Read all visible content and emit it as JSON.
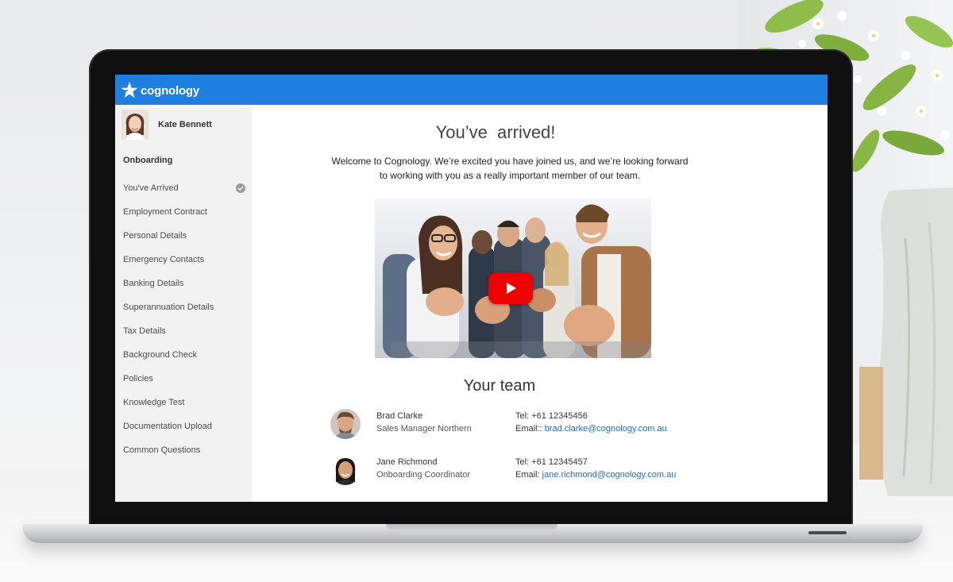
{
  "app": {
    "brand": "cognology",
    "colors": {
      "topbar": "#1f7fe0",
      "sidebar": "#f2f2f2",
      "link": "#1a6fd1",
      "play": "#ee0000"
    }
  },
  "user": {
    "name": "Kate Bennett"
  },
  "sidebar": {
    "section_title": "Onboarding",
    "items": [
      {
        "label": "You've Arrived",
        "completed": true
      },
      {
        "label": "Employment Contract"
      },
      {
        "label": "Personal Details"
      },
      {
        "label": "Emergency Contacts"
      },
      {
        "label": "Banking Details"
      },
      {
        "label": "Superannuation Details"
      },
      {
        "label": "Tax Details"
      },
      {
        "label": "Background Check"
      },
      {
        "label": "Policies"
      },
      {
        "label": "Knowledge Test"
      },
      {
        "label": "Documentation Upload"
      },
      {
        "label": "Common Questions"
      }
    ]
  },
  "main": {
    "title": "You’ve  arrived!",
    "intro": "Welcome to Cognology. We’re excited you have joined us, and we’re looking forward to working with you as a really important member of our team.",
    "video": {
      "icon": "youtube-play-icon"
    },
    "team_title": "Your team",
    "team": [
      {
        "name": "Brad Clarke",
        "role": "Sales Manager Northern",
        "tel": "Tel: +61 12345456",
        "email_label": "Email:: ",
        "email": "brad.clarke@cognology.com.au"
      },
      {
        "name": "Jane Richmond",
        "role": "Onboarding Coordinator",
        "tel": "Tel: +61 12345457",
        "email_label": "Email: ",
        "email": "jane.richmond@cognology.com.au"
      }
    ]
  }
}
